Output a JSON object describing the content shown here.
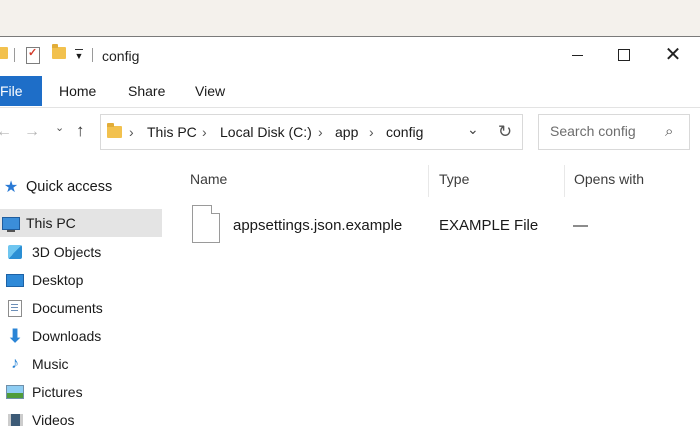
{
  "window": {
    "title": "config",
    "controls": {
      "minimize": "—",
      "maximize": "☐",
      "close": "✕"
    }
  },
  "ribbon": {
    "tabs": [
      "File",
      "Home",
      "Share",
      "View"
    ]
  },
  "navigation": {
    "back": "←",
    "forward": "→",
    "recent": "⌄",
    "up": "↑",
    "breadcrumb": [
      "This PC",
      "Local Disk (C:)",
      "app",
      "config"
    ],
    "separator": "›",
    "dropdown": "⌄",
    "refresh": "↻",
    "search_placeholder": "Search config",
    "search_icon": "⌕"
  },
  "sidebar": {
    "quick_access": "Quick access",
    "items": [
      {
        "label": "This PC",
        "icon": "this-pc-icon",
        "selected": true
      },
      {
        "label": "3D Objects",
        "icon": "3d-objects-icon"
      },
      {
        "label": "Desktop",
        "icon": "desktop-icon"
      },
      {
        "label": "Documents",
        "icon": "documents-icon"
      },
      {
        "label": "Downloads",
        "icon": "downloads-icon"
      },
      {
        "label": "Music",
        "icon": "music-icon"
      },
      {
        "label": "Pictures",
        "icon": "pictures-icon"
      },
      {
        "label": "Videos",
        "icon": "videos-icon"
      }
    ],
    "star_glyph": "★",
    "download_glyph": "⬇",
    "music_glyph": "♪"
  },
  "file_list": {
    "columns": [
      "Name",
      "Type",
      "Opens with"
    ],
    "rows": [
      {
        "name": "appsettings.json.example",
        "type": "EXAMPLE File",
        "opens_with": "—"
      }
    ]
  },
  "colors": {
    "accent": "#1e6ec8",
    "selection": "#e4e4e4"
  }
}
